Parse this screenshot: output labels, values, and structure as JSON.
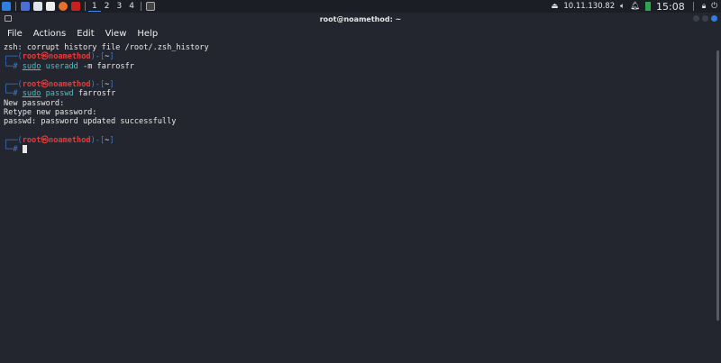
{
  "taskbar": {
    "workspaces": [
      "1",
      "2",
      "3",
      "4"
    ],
    "active_workspace": "1",
    "ip": "10.11.130.82",
    "clock": "15:08"
  },
  "window": {
    "title": "root@noamethod: ~"
  },
  "menu": [
    "File",
    "Actions",
    "Edit",
    "View",
    "Help"
  ],
  "terminal": {
    "warning": "zsh: corrupt history file /root/.zsh_history",
    "user": "root",
    "host": "noamethod",
    "dir": "~",
    "prompt_symbol": "#",
    "cmd1": {
      "sudo": "sudo",
      "bin": "useradd",
      "args": " -m farrosfr"
    },
    "cmd2": {
      "sudo": "sudo",
      "bin": "passwd",
      "args": " farrosfr"
    },
    "out": [
      "New password:",
      "Retype new password:",
      "passwd: password updated successfully"
    ]
  }
}
